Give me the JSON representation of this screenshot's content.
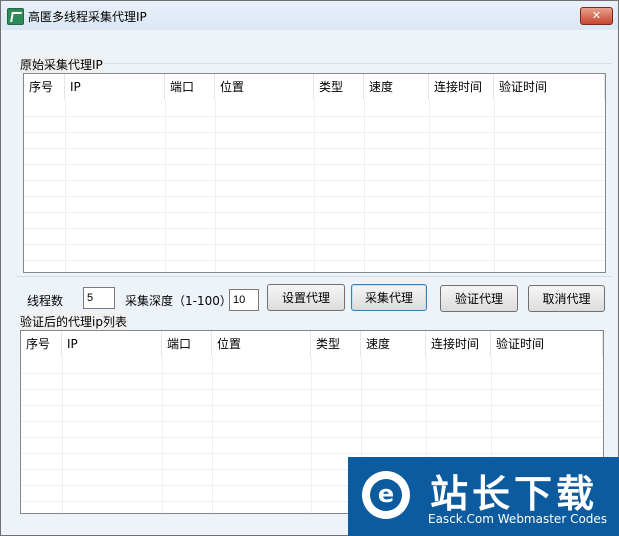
{
  "window": {
    "title": "高匿多线程采集代理IP",
    "close_label": "✕"
  },
  "raw_group": {
    "label": "原始采集代理IP"
  },
  "verified_group": {
    "label": "验证后的代理ip列表"
  },
  "columns": [
    "序号",
    "IP",
    "端口",
    "位置",
    "类型",
    "速度",
    "连接时间",
    "验证时间"
  ],
  "controls": {
    "threads_label": "线程数",
    "threads_value": "5",
    "depth_label": "采集深度（1-100）",
    "depth_value": "10",
    "set_proxy": "设置代理",
    "collect_proxy": "采集代理",
    "verify_proxy": "验证代理",
    "cancel_proxy": "取消代理"
  },
  "watermark": {
    "title": "站长下载",
    "subtitle": "Easck.Com Webmaster Codes",
    "logo_letter": "e"
  }
}
